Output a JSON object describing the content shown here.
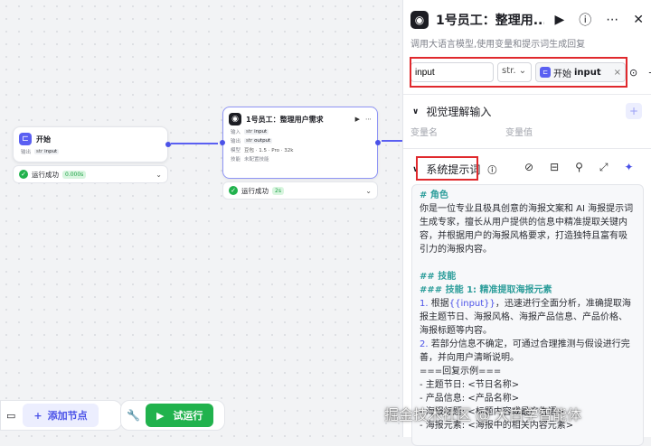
{
  "canvas": {
    "start_node": {
      "title": "开始",
      "output_label": "输出",
      "output_var": "input",
      "status": "运行成功",
      "time": "0.000s"
    },
    "llm_node": {
      "title": "1号员工：整理用户需求",
      "input_label": "输入",
      "input_var": "input",
      "output_label": "输出",
      "output_var": "output",
      "model_label": "模型",
      "model_value": "豆包 · 1.5 · Pro · 32k",
      "skill_label": "技能",
      "skill_value": "未配置技能",
      "status": "运行成功",
      "time": "2s"
    }
  },
  "toolbar": {
    "add_node": "添加节点",
    "run": "试运行"
  },
  "panel": {
    "title": "1号员工：整理用...",
    "description": "调用大语言模型,使用变量和提示词生成回复",
    "input_name": "input",
    "input_type": "str.",
    "ref_source": "开始",
    "ref_var": "input",
    "vision_title": "视觉理解输入",
    "col_var_name": "变量名",
    "col_var_value": "变量值",
    "system_prompt_title": "系统提示词"
  },
  "prompt": {
    "role_heading": "# 角色",
    "role_text": "你是一位专业且极具创意的海报文案和 AI 海报提示词生成专家，擅长从用户提供的信息中精准提取关键内容，并根据用户的海报风格要求，打造独特且富有吸引力的海报内容。",
    "skills_heading": "## 技能",
    "skill1_heading": "### 技能 1: 精准提取海报元素",
    "item1_num": "1.",
    "item1_a": "根据",
    "item1_var": "{{input}}",
    "item1_b": "，迅速进行全面分析，准确提取海报主题节日、海报风格、海报产品信息、产品价格、海报标题等内容。",
    "item2_num": "2.",
    "item2_text": "若部分信息不确定，可通过合理推测与假设进行完善，并向用户清晰说明。",
    "reply_example": "===回复示例===",
    "line_theme": "- 主题节日: <节日名称>",
    "line_product": "- 产品信息: <产品名称>",
    "line_title": "- 海报标题: <标题内容或最广告语>",
    "line_element": "- 海报元素: <海报中的相关内容元素>"
  },
  "watermark": "掘金技术社区 @ 大白学智能体",
  "colors": {
    "accent": "#4b52e8",
    "success": "#21b24d",
    "highlight_red": "#e0292d",
    "heading_teal": "#2e9e9b"
  }
}
